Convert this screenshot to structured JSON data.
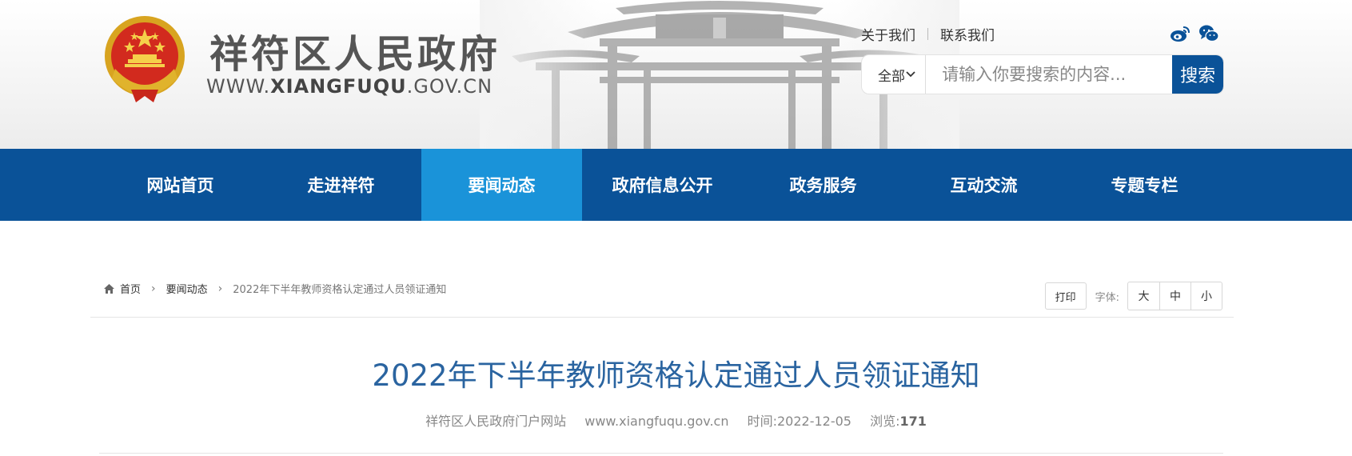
{
  "header": {
    "site_name": "祥符区人民政府",
    "site_url_prefix": "WWW.",
    "site_url_brand": "XIANGFUQU",
    "site_url_suffix": ".GOV.CN",
    "top_links": [
      "关于我们",
      "联系我们"
    ],
    "social": [
      "weibo-icon",
      "wechat-icon"
    ],
    "search": {
      "scope": "全部",
      "placeholder": "请输入你要搜索的内容...",
      "button": "搜索"
    },
    "colors": {
      "brand_blue": "#0a5298",
      "active_blue": "#1a93d9"
    }
  },
  "nav": {
    "items": [
      {
        "label": "网站首页"
      },
      {
        "label": "走进祥符"
      },
      {
        "label": "要闻动态"
      },
      {
        "label": "政府信息公开"
      },
      {
        "label": "政务服务"
      },
      {
        "label": "互动交流"
      },
      {
        "label": "专题专栏"
      }
    ],
    "active": "要闻动态"
  },
  "breadcrumb": {
    "home": "首页",
    "section": "要闻动态",
    "current": "2022年下半年教师资格认定通过人员领证通知"
  },
  "tools": {
    "print": "打印",
    "font_label": "字体:",
    "font_sizes": [
      "大",
      "中",
      "小"
    ]
  },
  "article": {
    "title": "2022年下半年教师资格认定通过人员领证通知",
    "source": "祥符区人民政府门户网站",
    "url": "www.xiangfuqu.gov.cn",
    "time_label": "时间:",
    "time": "2022-12-05",
    "views_label": "浏览:",
    "views": "171"
  }
}
